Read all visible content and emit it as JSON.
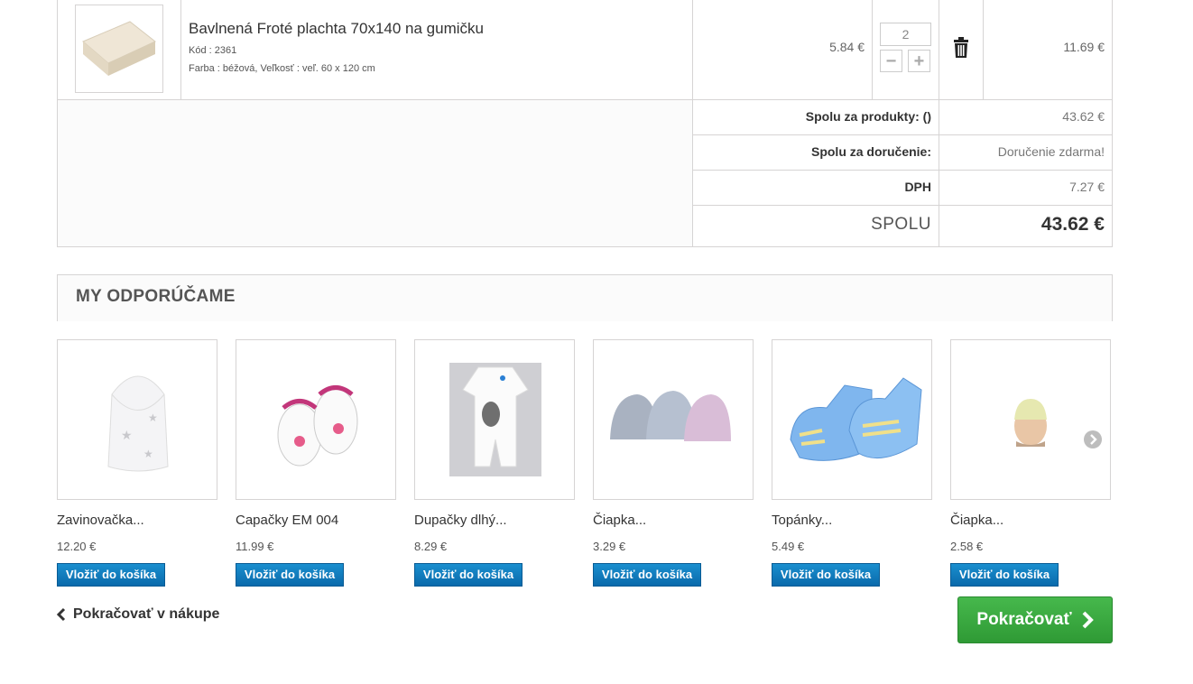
{
  "cart": {
    "product": {
      "name": "Bavlnená Froté plachta 70x140 na gumičku",
      "reference": "Kód : 2361",
      "attributes": "Farba : béžová, Veľkosť : veľ. 60 x 120 cm",
      "unit_price": "5.84 €",
      "quantity": "2",
      "minus": "−",
      "plus": "+",
      "line_total": "11.69 €"
    },
    "totals": {
      "products_label": "Spolu za produkty: ()",
      "products_value": "43.62 €",
      "shipping_label": "Spolu za doručenie:",
      "shipping_value": "Doručenie zdarma!",
      "tax_label": "DPH",
      "tax_value": "7.27 €",
      "total_label": "SPOLU",
      "total_value": "43.62 €"
    }
  },
  "recommendations": {
    "title": "MY ODPORÚČAME",
    "items": [
      {
        "name": "Zavinovačka...",
        "price": "12.20 €",
        "button": "Vložiť do košíka"
      },
      {
        "name": "Capačky EM 004",
        "price": "11.99 €",
        "button": "Vložiť do košíka"
      },
      {
        "name": "Dupačky dlhý...",
        "price": "8.29 €",
        "button": "Vložiť do košíka"
      },
      {
        "name": "Čiapka...",
        "price": "3.29 €",
        "button": "Vložiť do košíka"
      },
      {
        "name": "Topánky...",
        "price": "5.49 €",
        "button": "Vložiť do košíka"
      },
      {
        "name": "Čiapka...",
        "price": "2.58 €",
        "button": "Vložiť do košíka"
      }
    ]
  },
  "navigation": {
    "back_label": "Pokračovať v nákupe",
    "continue_label": "Pokračovať"
  },
  "colors": {
    "add_button": "#0a6aab",
    "continue_button": "#3aa940",
    "border": "#d6d4d4"
  },
  "icons": [
    "trash-icon",
    "chevron-left-icon",
    "chevron-right-icon",
    "carousel-next-icon"
  ]
}
